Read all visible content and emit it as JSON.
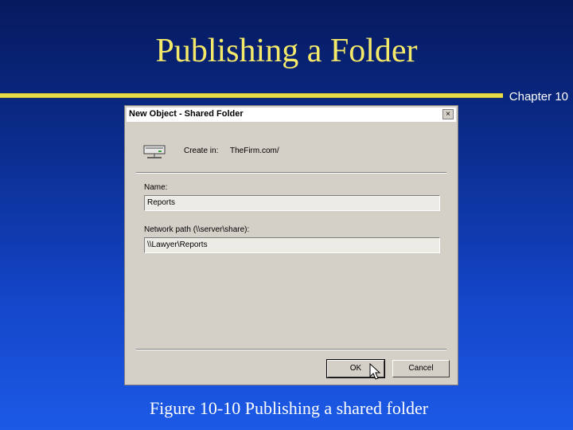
{
  "slide": {
    "title": "Publishing a Folder",
    "chapter": "Chapter 10",
    "caption": "Figure 10-10  Publishing a shared folder"
  },
  "dialog": {
    "title": "New Object - Shared Folder",
    "close_glyph": "×",
    "create_in_label": "Create in:",
    "create_in_value": "TheFirm.com/",
    "name_label": "Name:",
    "name_value": "Reports",
    "path_label": "Network path (\\\\server\\share):",
    "path_value": "\\\\Lawyer\\Reports",
    "ok_label": "OK",
    "cancel_label": "Cancel"
  },
  "icons": [
    "shared-folder-icon",
    "close-icon",
    "mouse-cursor-icon"
  ]
}
